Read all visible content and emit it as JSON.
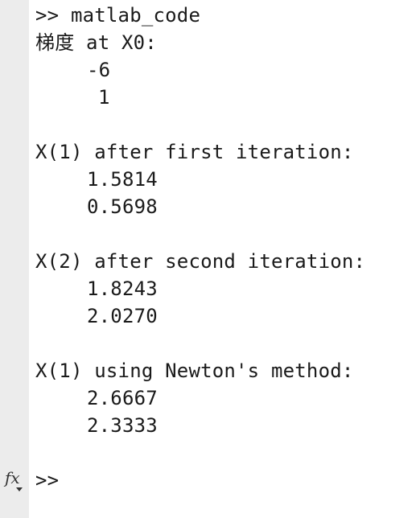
{
  "console": {
    "command_line": ">> matlab_code",
    "gradient_label": "梯度 at X0:",
    "gradient_values": [
      "-6",
      "1"
    ],
    "first_iteration_label": "X(1) after first iteration:",
    "first_iteration_values": [
      "1.5814",
      "0.5698"
    ],
    "second_iteration_label": "X(2) after second iteration:",
    "second_iteration_values": [
      "1.8243",
      "2.0270"
    ],
    "newton_label": "X(1) using Newton's method:",
    "newton_values": [
      "2.6667",
      "2.3333"
    ],
    "prompt": ">>"
  },
  "icons": {
    "function_browser": "fx-icon"
  }
}
